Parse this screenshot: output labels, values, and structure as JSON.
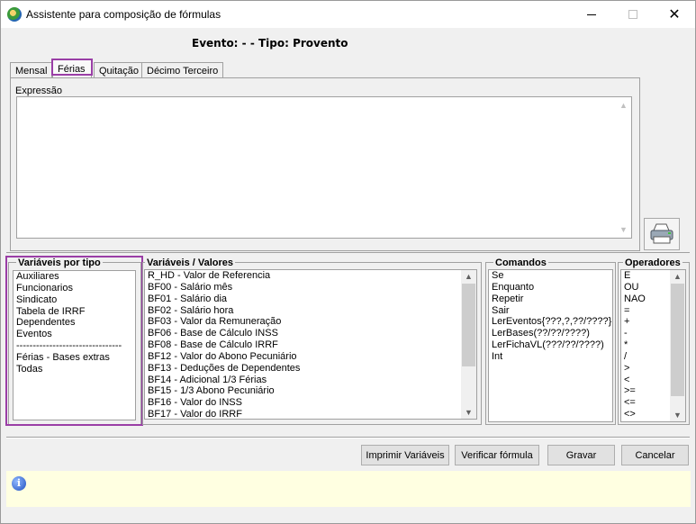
{
  "window": {
    "title": "Assistente para composição de fórmulas",
    "icon": "app-globe-icon"
  },
  "header": {
    "event_line": "Evento:  -  - Tipo: Provento"
  },
  "tabs": [
    {
      "label": "Mensal",
      "active": false
    },
    {
      "label": "Férias",
      "active": true
    },
    {
      "label": "Quitação",
      "active": false
    },
    {
      "label": "Décimo Terceiro",
      "active": false
    }
  ],
  "expression": {
    "label": "Expressão",
    "value": ""
  },
  "variaveis_tipo": {
    "title": "Variáveis por tipo",
    "items": [
      "Auxiliares",
      "Funcionarios",
      "Sindicato",
      "Tabela de IRRF",
      "Dependentes",
      "Eventos",
      "--------------------------------",
      "Férias - Bases extras",
      "Todas"
    ]
  },
  "variaveis_valores": {
    "title": "Variáveis / Valores",
    "items": [
      "R_HD - Valor de Referencia",
      "BF00 - Salário mês",
      "BF01 - Salário dia",
      "BF02 - Salário hora",
      "BF03 - Valor da Remuneração",
      "BF06 - Base de Cálculo INSS",
      "BF08 - Base de Cálculo IRRF",
      "BF12 - Valor do Abono Pecuniário",
      "BF13 - Deduções de Dependentes",
      "BF14 - Adicional 1/3 Férias",
      "BF15 - 1/3 Abono Pecuniário",
      "BF16 - Valor do INSS",
      "BF17 - Valor do IRRF"
    ]
  },
  "comandos": {
    "title": "Comandos",
    "items": [
      "Se",
      "Enquanto",
      "Repetir",
      "Sair",
      "LerEventos{???,?,??/????}",
      "LerBases(??/??/????)",
      "LerFichaVL(???/??/????)",
      "Int"
    ]
  },
  "operadores": {
    "title": "Operadores",
    "items": [
      "E",
      "OU",
      "NAO",
      "=",
      "+",
      "-",
      "*",
      "/",
      ">",
      "<",
      ">=",
      "<=",
      "<>"
    ]
  },
  "buttons": {
    "imprimir": "Imprimir Variáveis",
    "verificar": "Verificar fórmula",
    "gravar": "Gravar",
    "cancelar": "Cancelar"
  },
  "status": {
    "icon": "info-icon",
    "text": ""
  },
  "colors": {
    "highlight": "#9a3ea6",
    "status_bg": "#ffffe1"
  }
}
